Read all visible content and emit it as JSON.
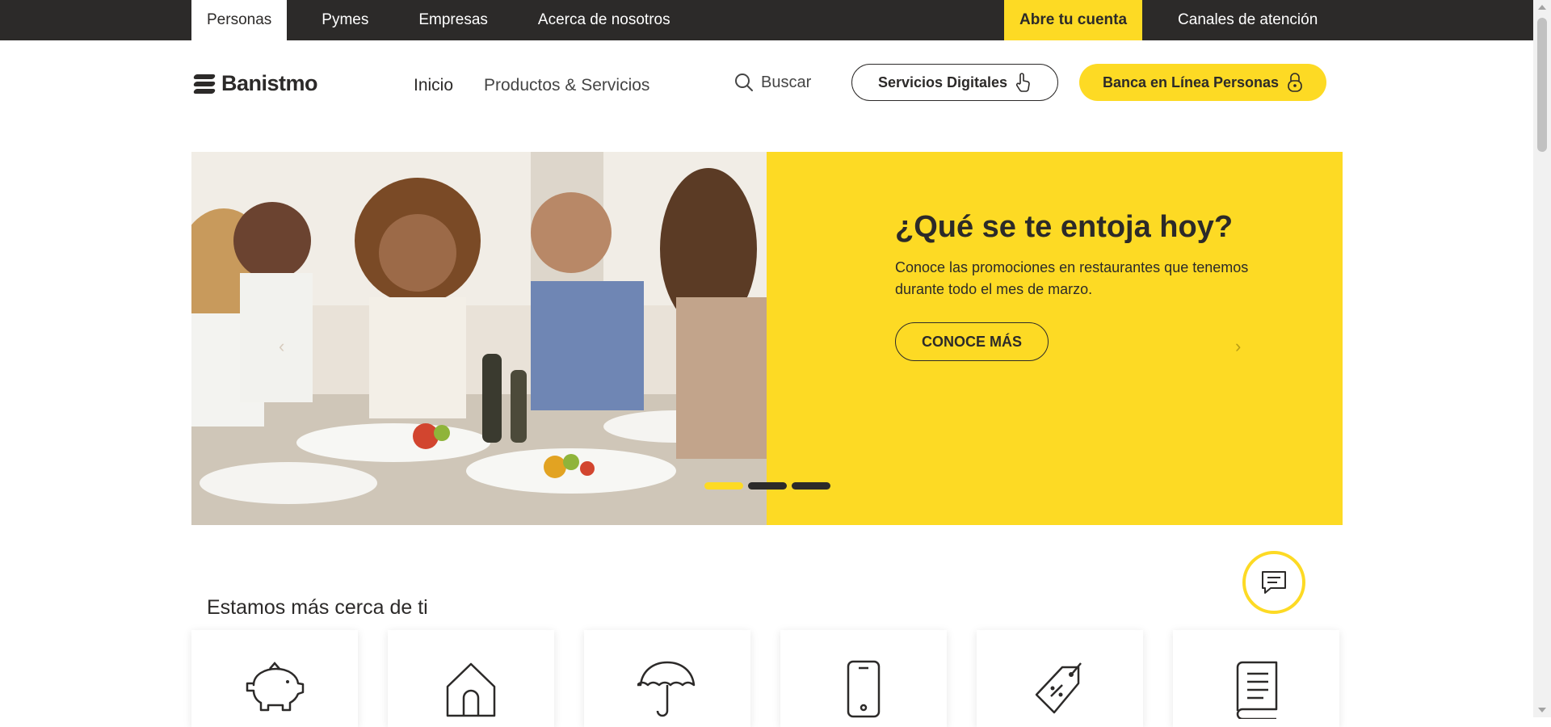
{
  "topbar": {
    "tabs": [
      {
        "label": "Personas",
        "active": true
      },
      {
        "label": "Pymes",
        "active": false
      },
      {
        "label": "Empresas",
        "active": false
      },
      {
        "label": "Acerca de nosotros",
        "active": false
      }
    ],
    "cta": "Abre tu cuenta",
    "channels": "Canales de atención"
  },
  "header": {
    "brand": "Banistmo",
    "nav": [
      {
        "label": "Inicio",
        "active": true
      },
      {
        "label": "Productos & Servicios",
        "active": false
      }
    ],
    "search_label": "Buscar",
    "digital_services": "Servicios Digitales",
    "online_banking": "Banca en Línea Personas"
  },
  "hero": {
    "title": "¿Qué se te entoja hoy?",
    "text": "Conoce las promociones en restaurantes que tenemos durante todo el mes de marzo.",
    "button": "CONOCE MÁS",
    "slides": 3,
    "active_slide": 1
  },
  "section": {
    "title": "Estamos más cerca de ti",
    "cards": [
      "piggy-bank-icon",
      "house-icon",
      "umbrella-icon",
      "smartphone-icon",
      "price-tag-icon",
      "book-icon"
    ]
  },
  "colors": {
    "brand_yellow": "#fdda24",
    "dark": "#2c2a29"
  }
}
